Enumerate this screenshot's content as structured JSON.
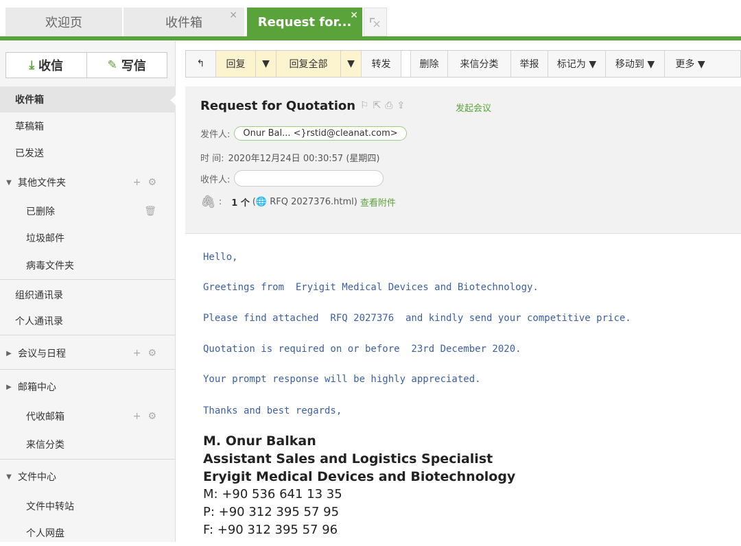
{
  "tabs": {
    "welcome": "欢迎页",
    "inbox": "收件箱",
    "rfq": "Request for...",
    "close": "×"
  },
  "compose": {
    "receive": "收信",
    "write": "写信"
  },
  "sidebar": {
    "inbox": "收件箱",
    "drafts": "草稿箱",
    "sent": "已发送",
    "other_folders": "其他文件夹",
    "deleted": "已删除",
    "junk": "垃圾邮件",
    "virus": "病毒文件夹",
    "org_contacts": "组织通讯录",
    "personal_contacts": "个人通讯录",
    "meetings": "会议与日程",
    "mail_center": "邮箱中心",
    "proxy_mail": "代收邮箱",
    "incoming_sort": "来信分类",
    "file_center": "文件中心",
    "file_transfer": "文件中转站",
    "personal_disk": "个人网盘"
  },
  "toolbar": {
    "back": "↰",
    "reply": "回复",
    "reply_all": "回复全部",
    "forward": "转发",
    "delete": "删除",
    "sort": "来信分类",
    "report": "举报",
    "mark": "标记为 ▼",
    "move": "移动到 ▼",
    "more": "更多 ▼",
    "dropdown": "▼"
  },
  "header": {
    "subject": "Request for Quotation",
    "meeting": "发起会议",
    "from_label": "发件人:",
    "from_value": "Onur Bal... <}rstid@cleanat.com>",
    "time_label": "时  间:",
    "time_value": "2020年12月24日 00:30:57 (星期四)",
    "to_label": "收件人:",
    "attach_label": ":",
    "attach_count": "1 个",
    "attach_file": "(🌐 RFQ 2027376.html)",
    "attach_view": "查看附件"
  },
  "body": {
    "line1": "Hello,",
    "line2": "Greetings from  Eryigit Medical Devices and Biotechnology.",
    "line3": "Please find attached  RFQ 2027376  and kindly send your competitive price.",
    "line4": "Quotation is required on or before  23rd December 2020.",
    "line5": "Your prompt response will be highly appreciated.",
    "line6": "Thanks and best regards,",
    "sig_name": "M. Onur Balkan",
    "sig_title": "Assistant Sales and Logistics Specialist",
    "sig_company": "Eryigit Medical Devices and Biotechnology",
    "sig_m": "M: +90 536 641 13 35",
    "sig_p": "P: +90 312 395 57 95",
    "sig_f": "F: +90 312 395 57 96"
  },
  "colors": {
    "accent": "#5aa33a",
    "body_text": "#3a5fa8"
  }
}
